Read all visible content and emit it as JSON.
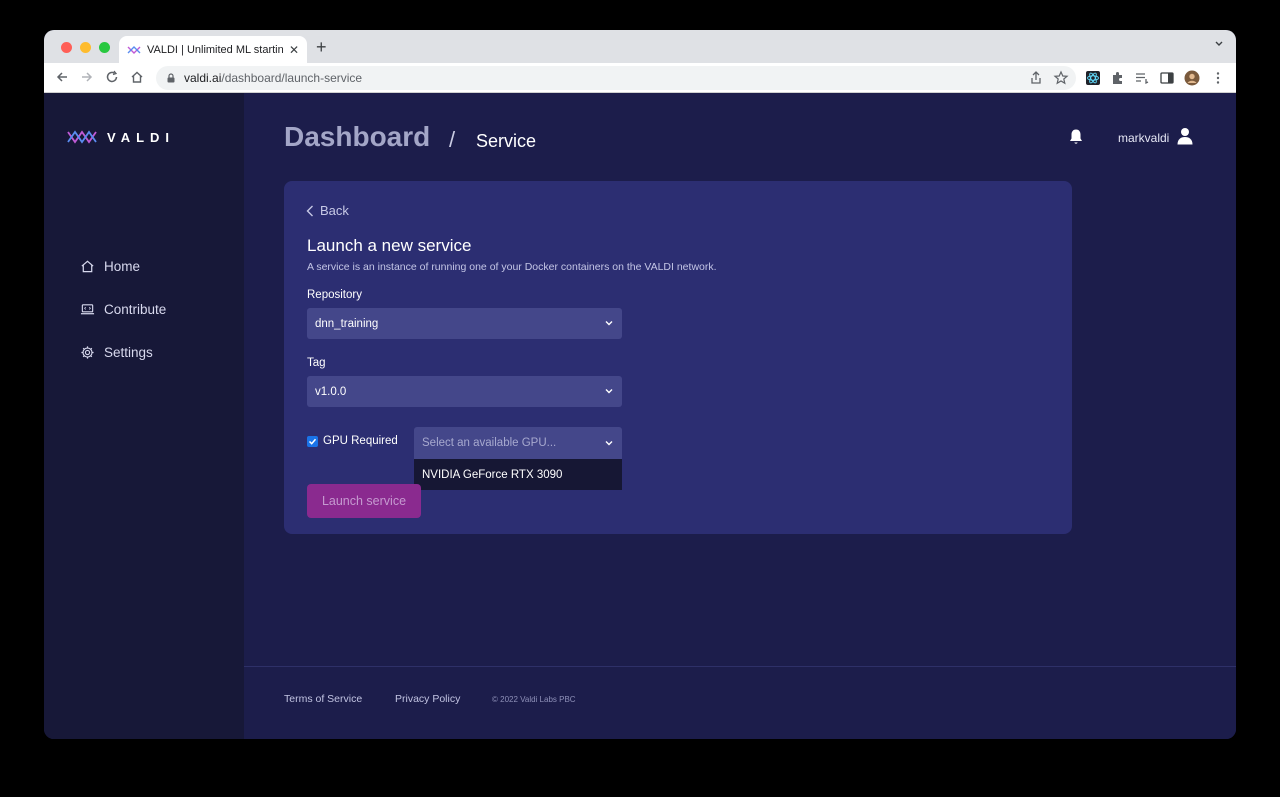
{
  "browser": {
    "tab_title": "VALDI | Unlimited ML starting a",
    "tab_close": "✕",
    "new_tab": "+",
    "url_host": "valdi.ai",
    "url_path": "/dashboard/launch-service"
  },
  "brand": {
    "wordmark": "VALDI"
  },
  "sidebar": {
    "items": [
      {
        "label": "Home",
        "icon": "home-icon"
      },
      {
        "label": "Contribute",
        "icon": "laptop-icon"
      },
      {
        "label": "Settings",
        "icon": "gear-icon"
      }
    ]
  },
  "header": {
    "title": "Dashboard",
    "separator": "/",
    "subtitle": "Service",
    "username": "markvaldi"
  },
  "form": {
    "back_label": "Back",
    "title": "Launch a new service",
    "description": "A service is an instance of running one of your Docker containers on the VALDI network.",
    "repository_label": "Repository",
    "repository_value": "dnn_training",
    "tag_label": "Tag",
    "tag_value": "v1.0.0",
    "gpu_required_label": "GPU Required",
    "gpu_required_checked": true,
    "gpu_placeholder": "Select an available GPU...",
    "gpu_options": [
      "NVIDIA GeForce RTX 3090"
    ],
    "launch_label": "Launch service"
  },
  "footer": {
    "terms": "Terms of Service",
    "privacy": "Privacy Policy",
    "copyright": "© 2022 Valdi Labs PBC"
  },
  "colors": {
    "sidebar_bg": "#171838",
    "page_bg": "#1c1d4b",
    "card_bg": "#2c2e72",
    "input_bg": "#44478a",
    "accent": "#8a2a8f"
  }
}
